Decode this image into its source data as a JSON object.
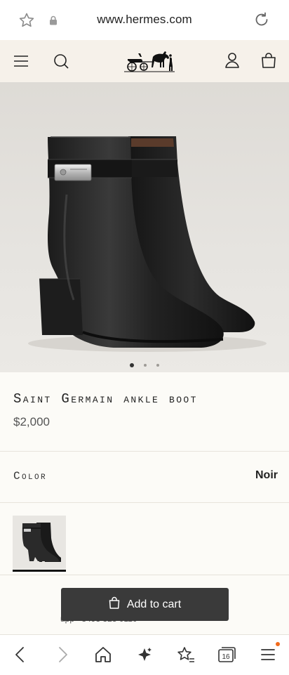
{
  "browser": {
    "url": "www.hermes.com",
    "icons": [
      "star-icon",
      "lock-icon",
      "reload-icon"
    ]
  },
  "site_header": {
    "icons": [
      "menu-icon",
      "search-icon",
      "account-icon",
      "bag-icon"
    ],
    "logo": "hermes-carriage-logo"
  },
  "hero": {
    "image": "black-leather-ankle-boots",
    "carousel_count": 3,
    "carousel_active": 1
  },
  "product": {
    "title": "Saint Germain ankle boot",
    "price": "$2,000"
  },
  "color": {
    "label": "Color",
    "value": "Noir"
  },
  "cart": {
    "label": "Add to cart",
    "behind_text": "upp +8493 323 0110"
  },
  "bottom_nav": {
    "icons": [
      "back-icon",
      "forward-icon",
      "home-icon",
      "sparkle-icon",
      "bookmark-star-icon",
      "tabs-icon",
      "menu-icon"
    ],
    "tabs_count": "16"
  },
  "colors": {
    "cart_bg": "#3a3a3a",
    "header_bg": "#f6f1ea",
    "badge": "#f26a1b"
  }
}
